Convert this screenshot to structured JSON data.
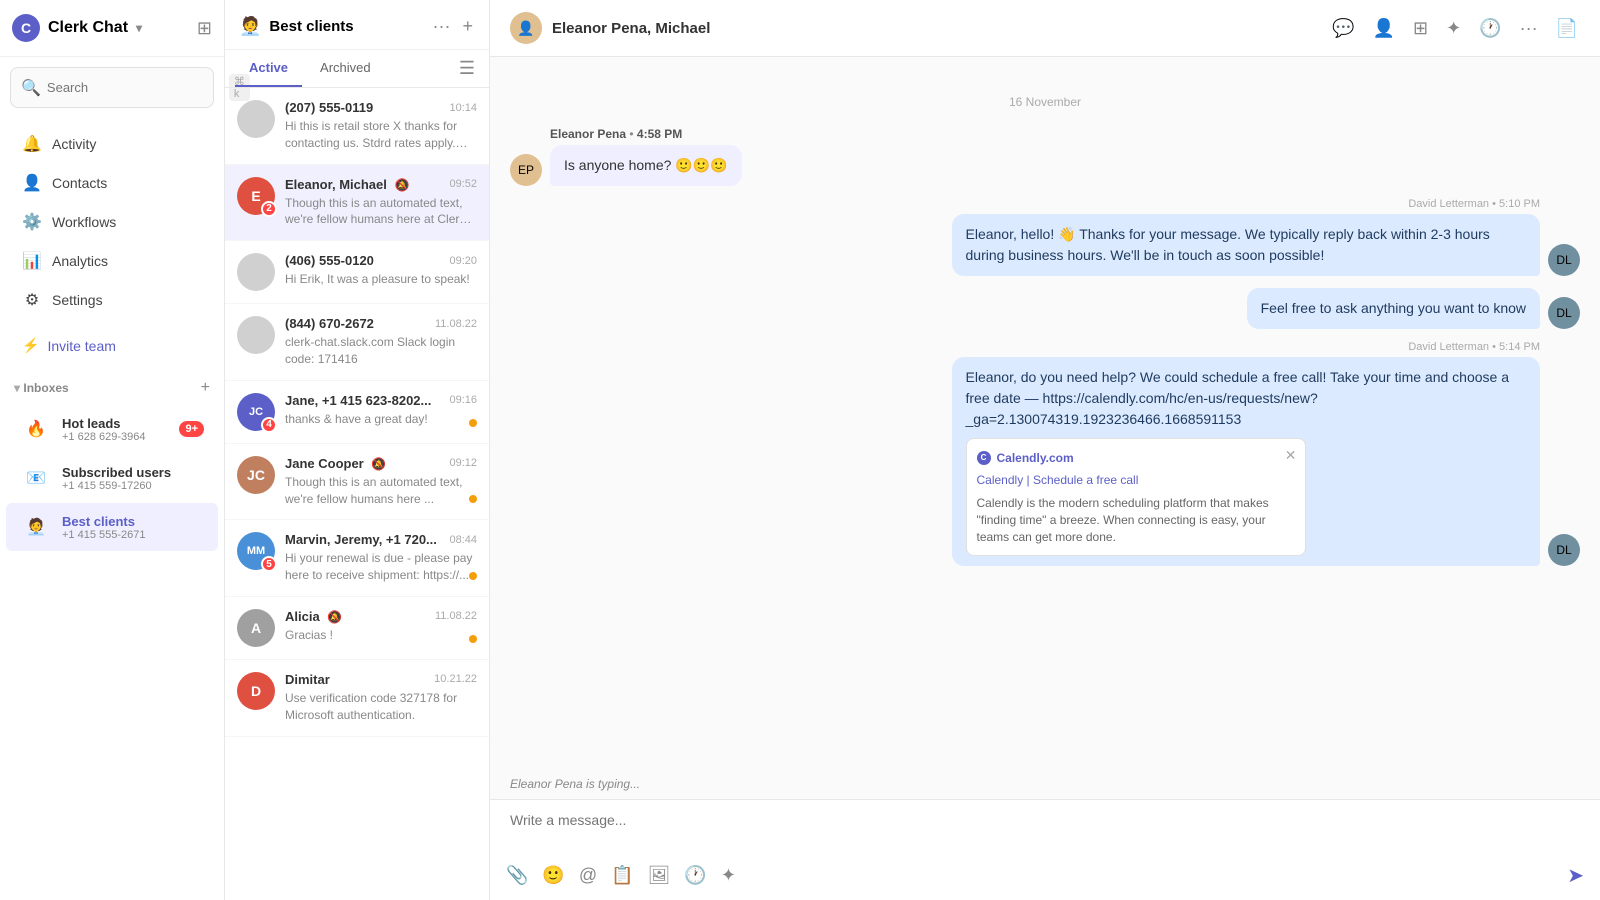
{
  "app": {
    "name": "Clerk Chat",
    "logo_char": "C"
  },
  "search": {
    "placeholder": "Search",
    "shortcut": "⌘ k"
  },
  "nav": {
    "items": [
      {
        "id": "activity",
        "label": "Activity",
        "icon": "🔔"
      },
      {
        "id": "contacts",
        "label": "Contacts",
        "icon": "👤"
      },
      {
        "id": "workflows",
        "label": "Workflows",
        "icon": "⚙️"
      },
      {
        "id": "analytics",
        "label": "Analytics",
        "icon": "📊"
      },
      {
        "id": "settings",
        "label": "Settings",
        "icon": "⚙"
      }
    ],
    "invite_team": "Invite team"
  },
  "inboxes": {
    "label": "Inboxes",
    "items": [
      {
        "id": "hot-leads",
        "name": "Hot leads",
        "phone": "+1 628 629-3964",
        "emoji": "🔥",
        "badge": "9+",
        "active": false
      },
      {
        "id": "subscribed-users",
        "name": "Subscribed users",
        "phone": "+1 415 559-17260",
        "emoji": "📧",
        "badge": null,
        "active": false
      },
      {
        "id": "best-clients",
        "name": "Best clients",
        "phone": "+1 415 555-2671",
        "emoji": "🧑‍💼",
        "badge": null,
        "active": true
      }
    ]
  },
  "conv_panel": {
    "title": "Best clients",
    "title_emoji": "🧑‍💼",
    "tabs": [
      {
        "id": "active",
        "label": "Active",
        "active": true
      },
      {
        "id": "archived",
        "label": "Archived",
        "active": false
      }
    ],
    "conversations": [
      {
        "id": "c1",
        "name": "(207) 555-0119",
        "time": "10:14",
        "preview": "Hi this is retail store X thanks for contacting us. Stdrd rates apply. te...",
        "avatar_color": "#d0d0d0",
        "avatar_char": "",
        "badge": null,
        "dot": false,
        "muted": false
      },
      {
        "id": "c2",
        "name": "Eleanor, Michael",
        "time": "09:52",
        "preview": "Though this is an automated text, we're fellow humans here at Clerk c...",
        "avatar_color": "#e05040",
        "avatar_char": "E",
        "badge": "2",
        "dot": false,
        "muted": true,
        "active": true
      },
      {
        "id": "c3",
        "name": "(406) 555-0120",
        "time": "09:20",
        "preview": "Hi Erik, It was a pleasure to speak!",
        "avatar_color": "#d0d0d0",
        "avatar_char": "",
        "badge": null,
        "dot": false,
        "muted": false
      },
      {
        "id": "c4",
        "name": "(844) 670-2672",
        "time": "11.08.22",
        "preview": "clerk-chat.slack.com Slack login code: 171416",
        "avatar_color": "#d0d0d0",
        "avatar_char": "",
        "badge": null,
        "dot": false,
        "muted": false
      },
      {
        "id": "c5",
        "name": "Jane, +1 415 623-8202...",
        "time": "09:16",
        "preview": "thanks & have a great day!",
        "avatar_color": "#5b5fc7",
        "avatar_char": "JC",
        "badge": "4",
        "dot": true,
        "muted": false
      },
      {
        "id": "c6",
        "name": "Jane Cooper",
        "time": "09:12",
        "preview": "Though this is an automated text, we're fellow humans here ...",
        "avatar_img": true,
        "avatar_color": "#c08060",
        "avatar_char": "JC",
        "badge": null,
        "dot": true,
        "muted": true
      },
      {
        "id": "c7",
        "name": "Marvin, Jeremy, +1 720...",
        "time": "08:44",
        "preview": "Hi your renewal is due - please pay here to receive shipment: https://...",
        "avatar_color": "#4a90d9",
        "avatar_char": "MM",
        "badge": "5",
        "dot": true,
        "muted": false
      },
      {
        "id": "c8",
        "name": "Alicia",
        "time": "11.08.22",
        "preview": "Gracias !",
        "avatar_color": "#d0d0d0",
        "avatar_char": "A",
        "badge": null,
        "dot": true,
        "muted": true
      },
      {
        "id": "c9",
        "name": "Dimitar",
        "time": "10.21.22",
        "preview": "Use verification code 327178 for Microsoft authentication.",
        "avatar_color": "#e05040",
        "avatar_char": "D",
        "badge": null,
        "dot": false,
        "muted": false
      }
    ]
  },
  "chat": {
    "contact_name": "Eleanor Pena, Michael",
    "date_divider": "16 November",
    "messages": [
      {
        "id": "m1",
        "direction": "incoming",
        "sender": "Eleanor Pena",
        "time": "4:58 PM",
        "text": "Is anyone home? 🙂🙂🙂"
      },
      {
        "id": "m2",
        "direction": "outgoing",
        "sender": "David Letterman",
        "time": "5:10 PM",
        "text": "Eleanor, hello! 👋 Thanks for your message. We typically reply back within 2-3 hours during business hours. We'll be in touch as soon possible!"
      },
      {
        "id": "m3",
        "direction": "outgoing",
        "sender": "David Letterman",
        "time": "",
        "text": "Feel free to ask anything you want to know"
      },
      {
        "id": "m4",
        "direction": "outgoing",
        "sender": "David Letterman",
        "time": "5:14 PM",
        "text": "Eleanor, do you need help? We could schedule a free call! Take your time and choose a free date — https://calendly.com/hc/en-us/requests/new?_ga=2.130074319.1923236466.1668591153",
        "link_preview": {
          "site": "Calendly.com",
          "links": "Calendly | Schedule a free call",
          "description": "Calendly is the modern scheduling platform that makes \"finding time\" a breeze. When connecting is easy, your teams can get more done."
        }
      }
    ],
    "typing_text": "Eleanor Pena is typing...",
    "input_placeholder": "Write a message..."
  }
}
